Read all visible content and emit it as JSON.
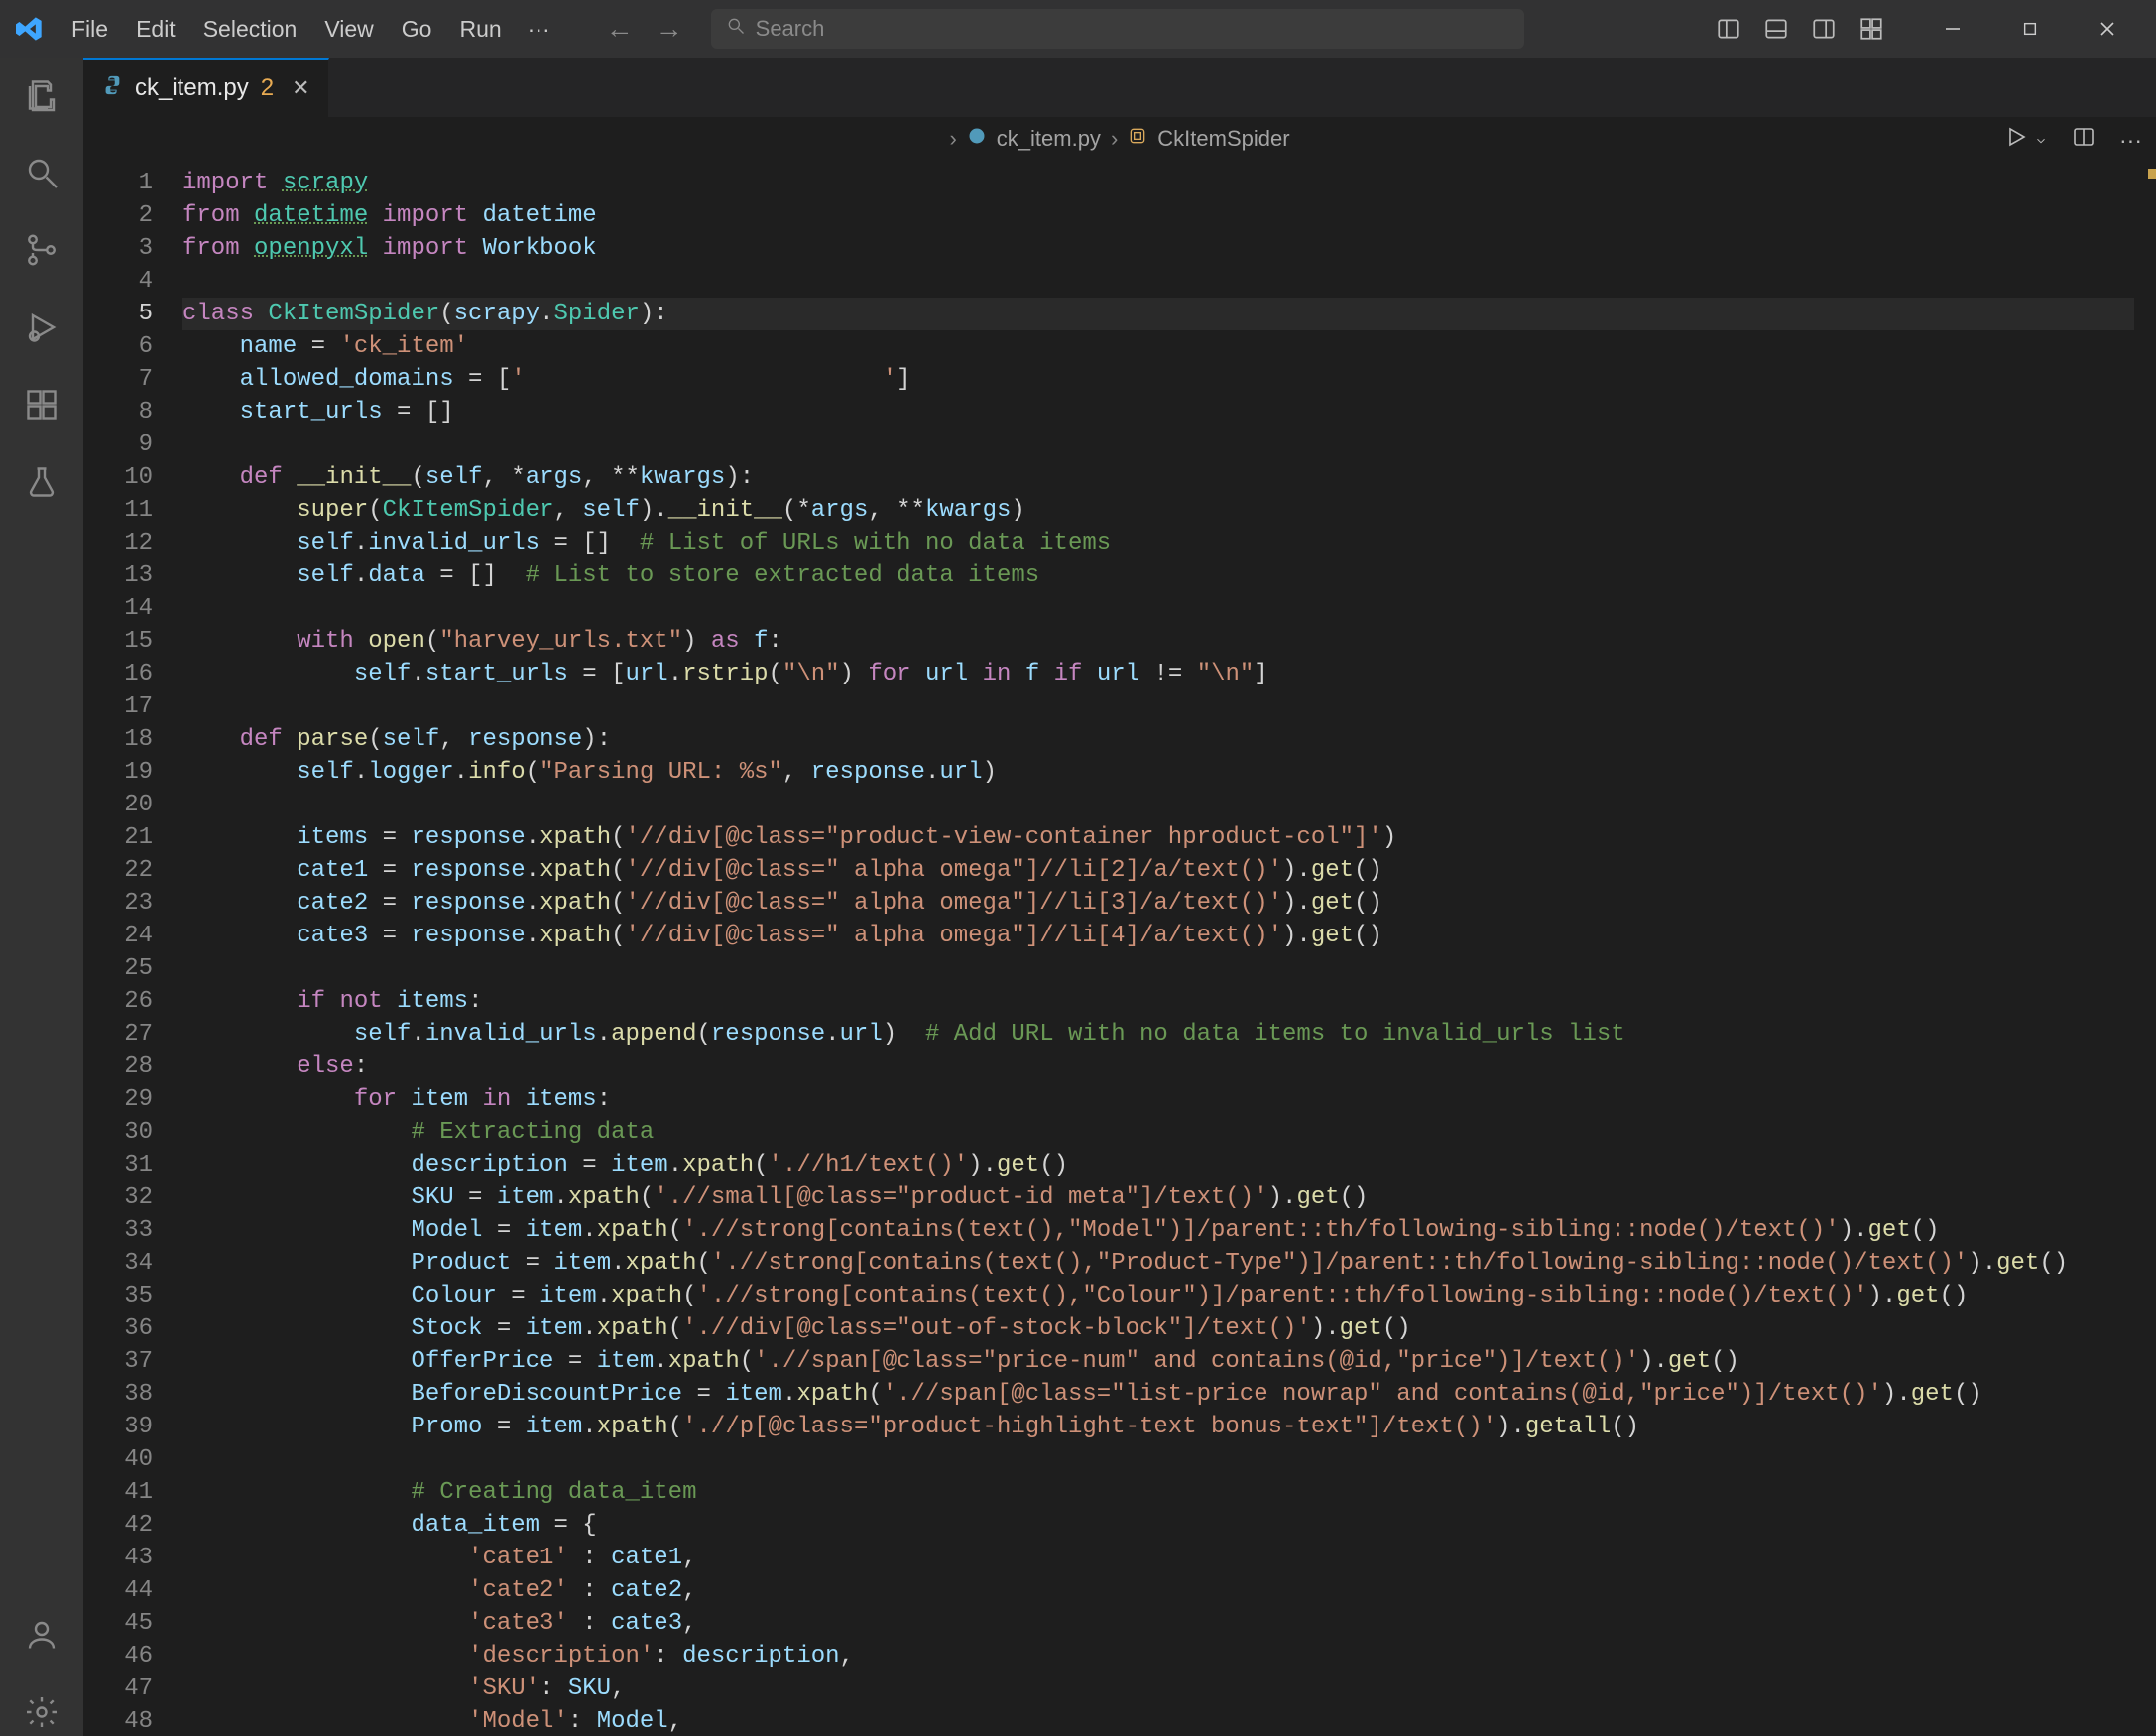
{
  "menu": {
    "items": [
      "File",
      "Edit",
      "Selection",
      "View",
      "Go",
      "Run"
    ],
    "more": "···"
  },
  "search": {
    "placeholder": "Search"
  },
  "tab": {
    "filename": "ck_item.py",
    "problem_count": "2"
  },
  "breadcrumbs": {
    "file": "ck_item.py",
    "class": "CkItemSpider"
  },
  "activity_icons": [
    "files-icon",
    "search-icon",
    "source-control-icon",
    "run-debug-icon",
    "extensions-icon",
    "beaker-icon"
  ],
  "activity_bottom_icons": [
    "account-icon",
    "settings-gear-icon"
  ],
  "line_count": 48,
  "active_line": 5,
  "code_lines": [
    [
      [
        "kw",
        "import"
      ],
      [
        "op",
        " "
      ],
      [
        "mod",
        "scrapy"
      ]
    ],
    [
      [
        "kw",
        "from"
      ],
      [
        "op",
        " "
      ],
      [
        "mod",
        "datetime"
      ],
      [
        "op",
        " "
      ],
      [
        "kw",
        "import"
      ],
      [
        "op",
        " "
      ],
      [
        "var",
        "datetime"
      ]
    ],
    [
      [
        "kw",
        "from"
      ],
      [
        "op",
        " "
      ],
      [
        "mod",
        "openpyxl"
      ],
      [
        "op",
        " "
      ],
      [
        "kw",
        "import"
      ],
      [
        "op",
        " "
      ],
      [
        "var",
        "Workbook"
      ]
    ],
    [],
    [
      [
        "kw",
        "class"
      ],
      [
        "op",
        " "
      ],
      [
        "cls",
        "CkItemSpider"
      ],
      [
        "op",
        "("
      ],
      [
        "var",
        "scrapy"
      ],
      [
        "op",
        "."
      ],
      [
        "cls",
        "Spider"
      ],
      [
        "op",
        "):"
      ]
    ],
    [
      [
        "op",
        "    "
      ],
      [
        "var",
        "name"
      ],
      [
        "op",
        " = "
      ],
      [
        "str",
        "'ck_item'"
      ]
    ],
    [
      [
        "op",
        "    "
      ],
      [
        "var",
        "allowed_domains"
      ],
      [
        "op",
        " = ["
      ],
      [
        "str",
        "'                         '"
      ],
      [
        "op",
        "]"
      ]
    ],
    [
      [
        "op",
        "    "
      ],
      [
        "var",
        "start_urls"
      ],
      [
        "op",
        " = []"
      ]
    ],
    [],
    [
      [
        "op",
        "    "
      ],
      [
        "kw",
        "def"
      ],
      [
        "op",
        " "
      ],
      [
        "dun",
        "__init__"
      ],
      [
        "op",
        "("
      ],
      [
        "var",
        "self"
      ],
      [
        "op",
        ", *"
      ],
      [
        "var",
        "args"
      ],
      [
        "op",
        ", **"
      ],
      [
        "var",
        "kwargs"
      ],
      [
        "op",
        "):"
      ]
    ],
    [
      [
        "op",
        "        "
      ],
      [
        "fn",
        "super"
      ],
      [
        "op",
        "("
      ],
      [
        "cls",
        "CkItemSpider"
      ],
      [
        "op",
        ", "
      ],
      [
        "var",
        "self"
      ],
      [
        "op",
        ")."
      ],
      [
        "dun",
        "__init__"
      ],
      [
        "op",
        "(*"
      ],
      [
        "var",
        "args"
      ],
      [
        "op",
        ", **"
      ],
      [
        "var",
        "kwargs"
      ],
      [
        "op",
        ")"
      ]
    ],
    [
      [
        "op",
        "        "
      ],
      [
        "var",
        "self"
      ],
      [
        "op",
        "."
      ],
      [
        "var",
        "invalid_urls"
      ],
      [
        "op",
        " = []  "
      ],
      [
        "cmt",
        "# List of URLs with no data items"
      ]
    ],
    [
      [
        "op",
        "        "
      ],
      [
        "var",
        "self"
      ],
      [
        "op",
        "."
      ],
      [
        "var",
        "data"
      ],
      [
        "op",
        " = []  "
      ],
      [
        "cmt",
        "# List to store extracted data items"
      ]
    ],
    [],
    [
      [
        "op",
        "        "
      ],
      [
        "kw",
        "with"
      ],
      [
        "op",
        " "
      ],
      [
        "fn",
        "open"
      ],
      [
        "op",
        "("
      ],
      [
        "str",
        "\"harvey_urls.txt\""
      ],
      [
        "op",
        ") "
      ],
      [
        "kw",
        "as"
      ],
      [
        "op",
        " "
      ],
      [
        "var",
        "f"
      ],
      [
        "op",
        ":"
      ]
    ],
    [
      [
        "op",
        "            "
      ],
      [
        "var",
        "self"
      ],
      [
        "op",
        "."
      ],
      [
        "var",
        "start_urls"
      ],
      [
        "op",
        " = ["
      ],
      [
        "var",
        "url"
      ],
      [
        "op",
        "."
      ],
      [
        "fn",
        "rstrip"
      ],
      [
        "op",
        "("
      ],
      [
        "str",
        "\"\\n\""
      ],
      [
        "op",
        ") "
      ],
      [
        "kw",
        "for"
      ],
      [
        "op",
        " "
      ],
      [
        "var",
        "url"
      ],
      [
        "op",
        " "
      ],
      [
        "kw",
        "in"
      ],
      [
        "op",
        " "
      ],
      [
        "var",
        "f"
      ],
      [
        "op",
        " "
      ],
      [
        "kw",
        "if"
      ],
      [
        "op",
        " "
      ],
      [
        "var",
        "url"
      ],
      [
        "op",
        " != "
      ],
      [
        "str",
        "\"\\n\""
      ],
      [
        "op",
        "]"
      ]
    ],
    [],
    [
      [
        "op",
        "    "
      ],
      [
        "kw",
        "def"
      ],
      [
        "op",
        " "
      ],
      [
        "fn",
        "parse"
      ],
      [
        "op",
        "("
      ],
      [
        "var",
        "self"
      ],
      [
        "op",
        ", "
      ],
      [
        "var",
        "response"
      ],
      [
        "op",
        "):"
      ]
    ],
    [
      [
        "op",
        "        "
      ],
      [
        "var",
        "self"
      ],
      [
        "op",
        "."
      ],
      [
        "var",
        "logger"
      ],
      [
        "op",
        "."
      ],
      [
        "fn",
        "info"
      ],
      [
        "op",
        "("
      ],
      [
        "str",
        "\"Parsing URL: %s\""
      ],
      [
        "op",
        ", "
      ],
      [
        "var",
        "response"
      ],
      [
        "op",
        "."
      ],
      [
        "var",
        "url"
      ],
      [
        "op",
        ")"
      ]
    ],
    [],
    [
      [
        "op",
        "        "
      ],
      [
        "var",
        "items"
      ],
      [
        "op",
        " = "
      ],
      [
        "var",
        "response"
      ],
      [
        "op",
        "."
      ],
      [
        "fn",
        "xpath"
      ],
      [
        "op",
        "("
      ],
      [
        "str",
        "'//div[@class=\"product-view-container hproduct-col\"]'"
      ],
      [
        "op",
        ")"
      ]
    ],
    [
      [
        "op",
        "        "
      ],
      [
        "var",
        "cate1"
      ],
      [
        "op",
        " = "
      ],
      [
        "var",
        "response"
      ],
      [
        "op",
        "."
      ],
      [
        "fn",
        "xpath"
      ],
      [
        "op",
        "("
      ],
      [
        "str",
        "'//div[@class=\" alpha omega\"]//li[2]/a/text()'"
      ],
      [
        "op",
        ")."
      ],
      [
        "fn",
        "get"
      ],
      [
        "op",
        "()"
      ]
    ],
    [
      [
        "op",
        "        "
      ],
      [
        "var",
        "cate2"
      ],
      [
        "op",
        " = "
      ],
      [
        "var",
        "response"
      ],
      [
        "op",
        "."
      ],
      [
        "fn",
        "xpath"
      ],
      [
        "op",
        "("
      ],
      [
        "str",
        "'//div[@class=\" alpha omega\"]//li[3]/a/text()'"
      ],
      [
        "op",
        ")."
      ],
      [
        "fn",
        "get"
      ],
      [
        "op",
        "()"
      ]
    ],
    [
      [
        "op",
        "        "
      ],
      [
        "var",
        "cate3"
      ],
      [
        "op",
        " = "
      ],
      [
        "var",
        "response"
      ],
      [
        "op",
        "."
      ],
      [
        "fn",
        "xpath"
      ],
      [
        "op",
        "("
      ],
      [
        "str",
        "'//div[@class=\" alpha omega\"]//li[4]/a/text()'"
      ],
      [
        "op",
        ")."
      ],
      [
        "fn",
        "get"
      ],
      [
        "op",
        "()"
      ]
    ],
    [],
    [
      [
        "op",
        "        "
      ],
      [
        "kw",
        "if"
      ],
      [
        "op",
        " "
      ],
      [
        "kw",
        "not"
      ],
      [
        "op",
        " "
      ],
      [
        "var",
        "items"
      ],
      [
        "op",
        ":"
      ]
    ],
    [
      [
        "op",
        "            "
      ],
      [
        "var",
        "self"
      ],
      [
        "op",
        "."
      ],
      [
        "var",
        "invalid_urls"
      ],
      [
        "op",
        "."
      ],
      [
        "fn",
        "append"
      ],
      [
        "op",
        "("
      ],
      [
        "var",
        "response"
      ],
      [
        "op",
        "."
      ],
      [
        "var",
        "url"
      ],
      [
        "op",
        ")  "
      ],
      [
        "cmt",
        "# Add URL with no data items to invalid_urls list"
      ]
    ],
    [
      [
        "op",
        "        "
      ],
      [
        "kw",
        "else"
      ],
      [
        "op",
        ":"
      ]
    ],
    [
      [
        "op",
        "            "
      ],
      [
        "kw",
        "for"
      ],
      [
        "op",
        " "
      ],
      [
        "var",
        "item"
      ],
      [
        "op",
        " "
      ],
      [
        "kw",
        "in"
      ],
      [
        "op",
        " "
      ],
      [
        "var",
        "items"
      ],
      [
        "op",
        ":"
      ]
    ],
    [
      [
        "op",
        "                "
      ],
      [
        "cmt",
        "# Extracting data"
      ]
    ],
    [
      [
        "op",
        "                "
      ],
      [
        "var",
        "description"
      ],
      [
        "op",
        " = "
      ],
      [
        "var",
        "item"
      ],
      [
        "op",
        "."
      ],
      [
        "fn",
        "xpath"
      ],
      [
        "op",
        "("
      ],
      [
        "str",
        "'.//h1/text()'"
      ],
      [
        "op",
        ")."
      ],
      [
        "fn",
        "get"
      ],
      [
        "op",
        "()"
      ]
    ],
    [
      [
        "op",
        "                "
      ],
      [
        "var",
        "SKU"
      ],
      [
        "op",
        " = "
      ],
      [
        "var",
        "item"
      ],
      [
        "op",
        "."
      ],
      [
        "fn",
        "xpath"
      ],
      [
        "op",
        "("
      ],
      [
        "str",
        "'.//small[@class=\"product-id meta\"]/text()'"
      ],
      [
        "op",
        ")."
      ],
      [
        "fn",
        "get"
      ],
      [
        "op",
        "()"
      ]
    ],
    [
      [
        "op",
        "                "
      ],
      [
        "var",
        "Model"
      ],
      [
        "op",
        " = "
      ],
      [
        "var",
        "item"
      ],
      [
        "op",
        "."
      ],
      [
        "fn",
        "xpath"
      ],
      [
        "op",
        "("
      ],
      [
        "str",
        "'.//strong[contains(text(),\"Model\")]/parent::th/following-sibling::node()/text()'"
      ],
      [
        "op",
        ")."
      ],
      [
        "fn",
        "get"
      ],
      [
        "op",
        "()"
      ]
    ],
    [
      [
        "op",
        "                "
      ],
      [
        "var",
        "Product"
      ],
      [
        "op",
        " = "
      ],
      [
        "var",
        "item"
      ],
      [
        "op",
        "."
      ],
      [
        "fn",
        "xpath"
      ],
      [
        "op",
        "("
      ],
      [
        "str",
        "'.//strong[contains(text(),\"Product-Type\")]/parent::th/following-sibling::node()/text()'"
      ],
      [
        "op",
        ")."
      ],
      [
        "fn",
        "get"
      ],
      [
        "op",
        "()"
      ]
    ],
    [
      [
        "op",
        "                "
      ],
      [
        "var",
        "Colour"
      ],
      [
        "op",
        " = "
      ],
      [
        "var",
        "item"
      ],
      [
        "op",
        "."
      ],
      [
        "fn",
        "xpath"
      ],
      [
        "op",
        "("
      ],
      [
        "str",
        "'.//strong[contains(text(),\"Colour\")]/parent::th/following-sibling::node()/text()'"
      ],
      [
        "op",
        ")."
      ],
      [
        "fn",
        "get"
      ],
      [
        "op",
        "()"
      ]
    ],
    [
      [
        "op",
        "                "
      ],
      [
        "var",
        "Stock"
      ],
      [
        "op",
        " = "
      ],
      [
        "var",
        "item"
      ],
      [
        "op",
        "."
      ],
      [
        "fn",
        "xpath"
      ],
      [
        "op",
        "("
      ],
      [
        "str",
        "'.//div[@class=\"out-of-stock-block\"]/text()'"
      ],
      [
        "op",
        ")."
      ],
      [
        "fn",
        "get"
      ],
      [
        "op",
        "()"
      ]
    ],
    [
      [
        "op",
        "                "
      ],
      [
        "var",
        "OfferPrice"
      ],
      [
        "op",
        " = "
      ],
      [
        "var",
        "item"
      ],
      [
        "op",
        "."
      ],
      [
        "fn",
        "xpath"
      ],
      [
        "op",
        "("
      ],
      [
        "str",
        "'.//span[@class=\"price-num\" and contains(@id,\"price\")]/text()'"
      ],
      [
        "op",
        ")."
      ],
      [
        "fn",
        "get"
      ],
      [
        "op",
        "()"
      ]
    ],
    [
      [
        "op",
        "                "
      ],
      [
        "var",
        "BeforeDiscountPrice"
      ],
      [
        "op",
        " = "
      ],
      [
        "var",
        "item"
      ],
      [
        "op",
        "."
      ],
      [
        "fn",
        "xpath"
      ],
      [
        "op",
        "("
      ],
      [
        "str",
        "'.//span[@class=\"list-price nowrap\" and contains(@id,\"price\")]/text()'"
      ],
      [
        "op",
        ")."
      ],
      [
        "fn",
        "get"
      ],
      [
        "op",
        "()"
      ]
    ],
    [
      [
        "op",
        "                "
      ],
      [
        "var",
        "Promo"
      ],
      [
        "op",
        " = "
      ],
      [
        "var",
        "item"
      ],
      [
        "op",
        "."
      ],
      [
        "fn",
        "xpath"
      ],
      [
        "op",
        "("
      ],
      [
        "str",
        "'.//p[@class=\"product-highlight-text bonus-text\"]/text()'"
      ],
      [
        "op",
        ")."
      ],
      [
        "fn",
        "getall"
      ],
      [
        "op",
        "()"
      ]
    ],
    [],
    [
      [
        "op",
        "                "
      ],
      [
        "cmt",
        "# Creating data_item"
      ]
    ],
    [
      [
        "op",
        "                "
      ],
      [
        "var",
        "data_item"
      ],
      [
        "op",
        " = {"
      ]
    ],
    [
      [
        "op",
        "                    "
      ],
      [
        "str",
        "'cate1'"
      ],
      [
        "op",
        " : "
      ],
      [
        "var",
        "cate1"
      ],
      [
        "op",
        ","
      ]
    ],
    [
      [
        "op",
        "                    "
      ],
      [
        "str",
        "'cate2'"
      ],
      [
        "op",
        " : "
      ],
      [
        "var",
        "cate2"
      ],
      [
        "op",
        ","
      ]
    ],
    [
      [
        "op",
        "                    "
      ],
      [
        "str",
        "'cate3'"
      ],
      [
        "op",
        " : "
      ],
      [
        "var",
        "cate3"
      ],
      [
        "op",
        ","
      ]
    ],
    [
      [
        "op",
        "                    "
      ],
      [
        "str",
        "'description'"
      ],
      [
        "op",
        ": "
      ],
      [
        "var",
        "description"
      ],
      [
        "op",
        ","
      ]
    ],
    [
      [
        "op",
        "                    "
      ],
      [
        "str",
        "'SKU'"
      ],
      [
        "op",
        ": "
      ],
      [
        "var",
        "SKU"
      ],
      [
        "op",
        ","
      ]
    ],
    [
      [
        "op",
        "                    "
      ],
      [
        "str",
        "'Model'"
      ],
      [
        "op",
        ": "
      ],
      [
        "var",
        "Model"
      ],
      [
        "op",
        ","
      ]
    ]
  ]
}
